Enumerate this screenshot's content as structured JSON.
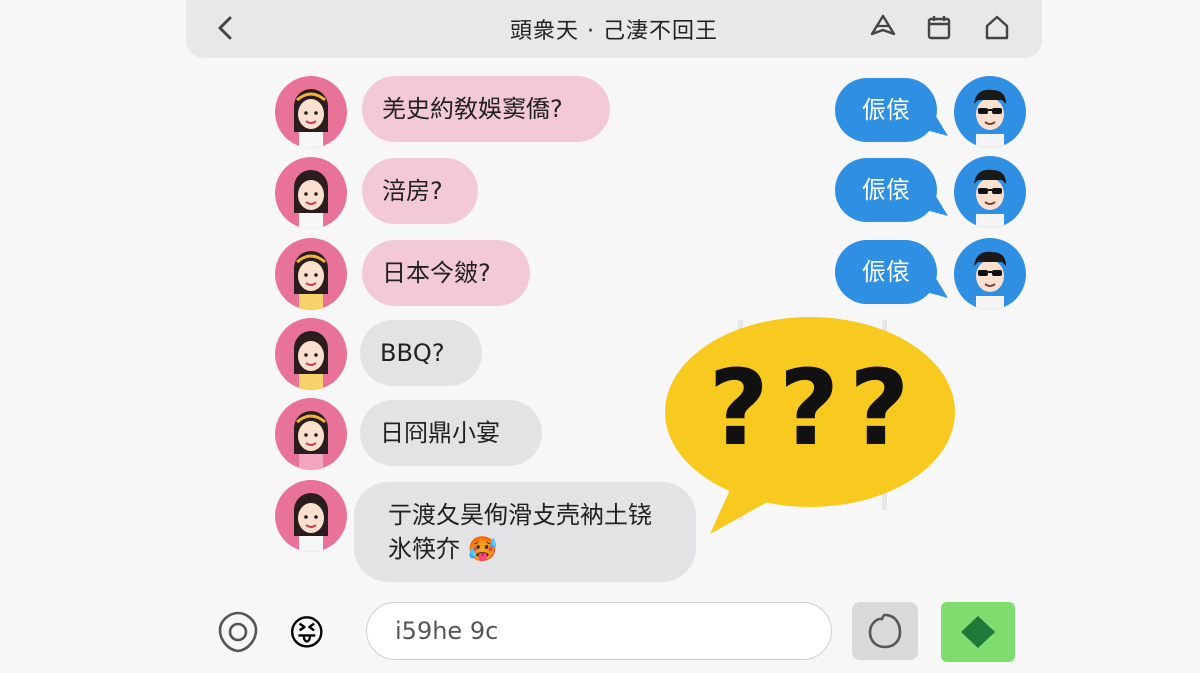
{
  "header": {
    "title": "頭衆天 · 己淒不回王",
    "back_icon": "chevron-left-icon",
    "action_icons": [
      "tag-icon",
      "calendar-icon",
      "home-icon"
    ]
  },
  "messages_left": [
    {
      "text": "羌史約敎娛窦僑?",
      "style": "pink"
    },
    {
      "text": "涪房?",
      "style": "pink"
    },
    {
      "text": "日本今皴?",
      "style": "pink"
    },
    {
      "text": "BBQ?",
      "style": "gray"
    },
    {
      "text": "日冏鼎小宴",
      "style": "gray"
    },
    {
      "text": "亍渡夂昊侚滑攴壳衲土铙",
      "text2": "氷筷夰 🥵",
      "style": "gray"
    }
  ],
  "messages_right": [
    {
      "text": "侲偯"
    },
    {
      "text": "侲偯"
    },
    {
      "text": "侲偯"
    }
  ],
  "reaction": {
    "text": "???",
    "color": "#f8c91e"
  },
  "input": {
    "value": "i59he  9c",
    "emoji": "😝",
    "left_icon": "voice-icon",
    "attach_icon": "sticker-icon",
    "send_icon": "send-icon"
  },
  "colors": {
    "pink_bubble": "#f4c9d6",
    "gray_bubble": "#e3e3e6",
    "blue_bubble": "#2f8fe3",
    "send_button": "#7fdc6f",
    "girl_avatar_bg": "#e97398"
  }
}
